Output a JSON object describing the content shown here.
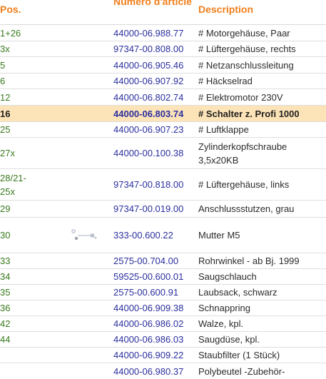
{
  "table": {
    "headers": {
      "pos": "Pos.",
      "number": "Numéro d'article",
      "description": "Description"
    },
    "rows": [
      {
        "pos": "1+26",
        "number": "44000-06.988.77",
        "description": "# Motorgehäuse, Paar"
      },
      {
        "pos": "3x",
        "number": "97347-00.808.00",
        "description": "# Lüftergehäuse, rechts"
      },
      {
        "pos": "5",
        "number": "44000-06.905.46",
        "description": "# Netzanschlussleitung"
      },
      {
        "pos": "6",
        "number": "44000-06.907.92",
        "description": "# Häckselrad"
      },
      {
        "pos": "12",
        "number": "44000-06.802.74",
        "description": "# Elektromotor 230V"
      },
      {
        "pos": "16",
        "number": "44000-06.803.74",
        "description": "# Schalter z. Profi 1000"
      },
      {
        "pos": "25",
        "number": "44000-06.907.23",
        "description": "# Luftklappe"
      },
      {
        "pos": "27x",
        "number": "44000-00.100.38",
        "description": "Zylinderkopfschraube 3,5x20KB"
      },
      {
        "pos": "28/21-25x",
        "number": "97347-00.818.00",
        "description": "# Lüftergehäuse, links"
      },
      {
        "pos": "29",
        "number": "97347-00.019.00",
        "description": "Anschlussstutzen, grau"
      },
      {
        "pos": "30",
        "number": "333-00.600.22",
        "description": "Mutter M5"
      },
      {
        "pos": "33",
        "number": "2575-00.704.00",
        "description": "Rohrwinkel - ab Bj. 1999"
      },
      {
        "pos": "34",
        "number": "59525-00.600.01",
        "description": "Saugschlauch"
      },
      {
        "pos": "35",
        "number": "2575-00.600.91",
        "description": "Laubsack, schwarz"
      },
      {
        "pos": "36",
        "number": "44000-06.909.38",
        "description": "Schnappring"
      },
      {
        "pos": "42",
        "number": "44000-06.986.02",
        "description": "Walze, kpl."
      },
      {
        "pos": "44",
        "number": "44000-06.986.03",
        "description": "Saugdüse, kpl."
      },
      {
        "pos": "",
        "number": "44000-06.909.22",
        "description": "Staubfilter (1 Stück)"
      },
      {
        "pos": "",
        "number": "44000-06.980.37",
        "description": "Polybeutel -Zubehör-"
      }
    ]
  },
  "colors": {
    "header": "#f07f1c",
    "position": "#3a7a1e",
    "part_number": "#2a2f9e",
    "highlight_row": "#fde4b8"
  },
  "highlighted_row_pos": "16",
  "thumbnail_row_pos": "30",
  "thumbnail_icon": "nut-screw-thumbnail"
}
